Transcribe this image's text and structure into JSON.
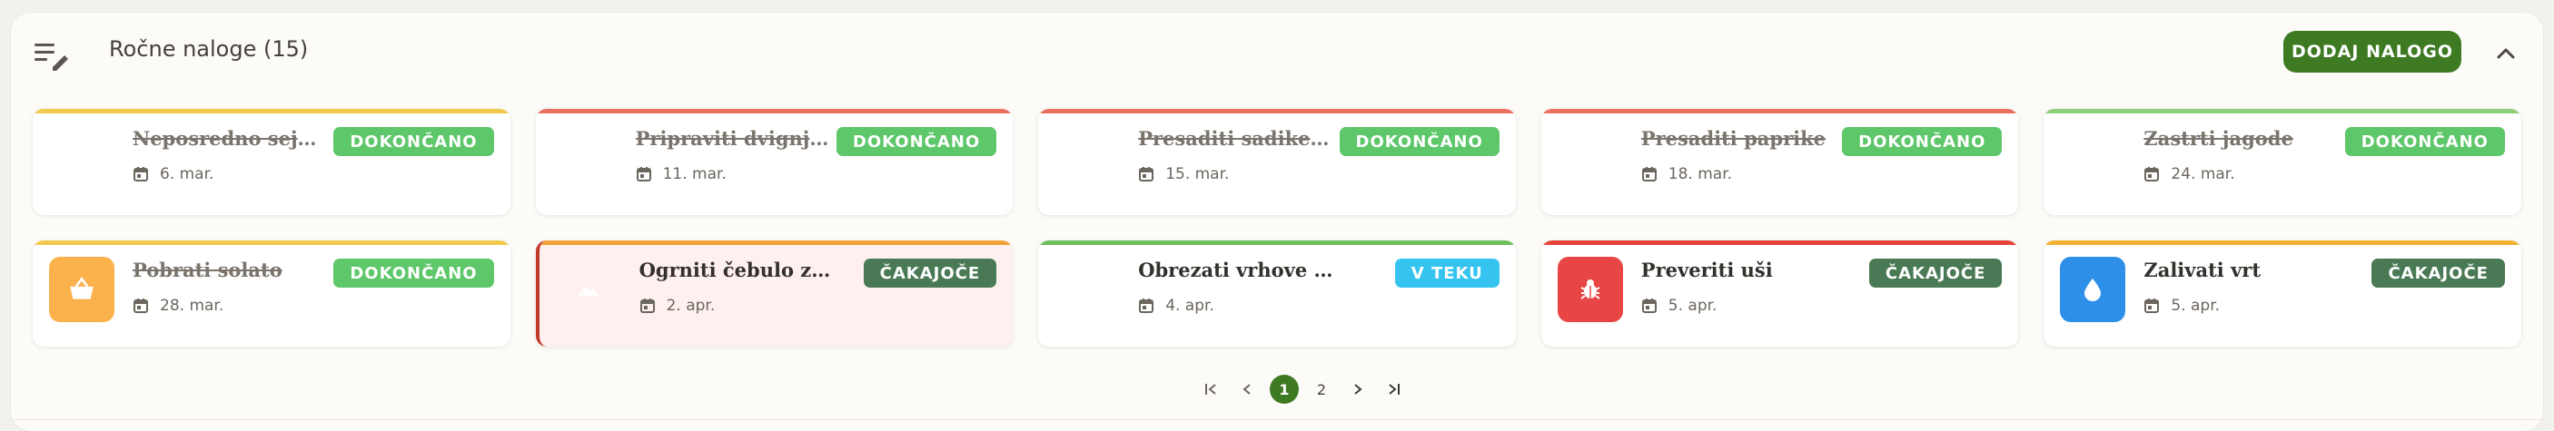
{
  "header": {
    "title": "Ročne naloge (15)",
    "add_button": "DODAJ NALOGO"
  },
  "tasks": [
    {
      "name": "Neposredno sejati ko…",
      "date": "6. mar.",
      "status": "DOKONČANO",
      "kind": "done",
      "accent": "#f2c94c"
    },
    {
      "name": "Pripraviti dvignjene g…",
      "date": "11. mar.",
      "status": "DOKONČANO",
      "kind": "done",
      "accent": "#eb6f5f"
    },
    {
      "name": "Presaditi sadike para…",
      "date": "15. mar.",
      "status": "DOKONČANO",
      "kind": "done",
      "accent": "#eb6f5f"
    },
    {
      "name": "Presaditi paprike",
      "date": "18. mar.",
      "status": "DOKONČANO",
      "kind": "done",
      "accent": "#eb6f5f"
    },
    {
      "name": "Zastrti jagode",
      "date": "24. mar.",
      "status": "DOKONČANO",
      "kind": "done",
      "accent": "#8fcf7a"
    },
    {
      "name": "Pobrati solato",
      "date": "28. mar.",
      "status": "DOKONČANO",
      "kind": "done",
      "accent": "#f2c94c",
      "icon": "basket-icon",
      "icon_bg": "#fbb24c"
    },
    {
      "name": "Ogrniti čebulo z zemljo",
      "date": "2. apr.",
      "status": "ČAKAJOČE",
      "kind": "wait",
      "accent": "#f2a33c",
      "icon": "mountain-icon"
    },
    {
      "name": "Obrezati vrhove bazilike",
      "date": "4. apr.",
      "status": "V TEKU",
      "kind": "prog",
      "accent": "#6cbf5a"
    },
    {
      "name": "Preveriti uši",
      "date": "5. apr.",
      "status": "ČAKAJOČE",
      "kind": "wait",
      "accent": "#e8433a",
      "icon": "bug-icon",
      "icon_bg": "#e84545"
    },
    {
      "name": "Zalivati vrt",
      "date": "5. apr.",
      "status": "ČAKAJOČE",
      "kind": "wait",
      "accent": "#f2b233",
      "icon": "water-drop-icon",
      "icon_bg": "#2e8fe8"
    }
  ],
  "pagination": {
    "pages": [
      "1",
      "2"
    ],
    "current": "1"
  }
}
